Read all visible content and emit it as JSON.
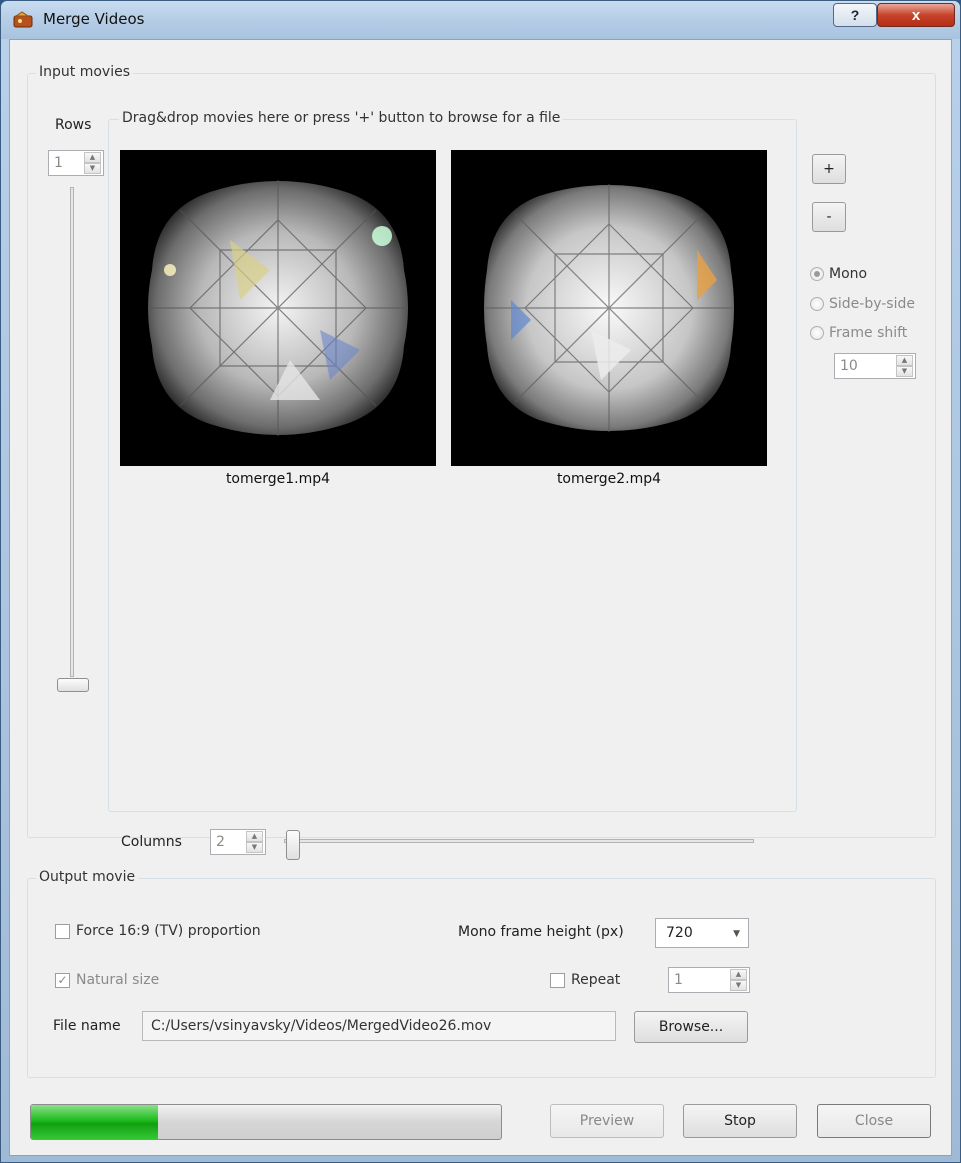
{
  "window": {
    "title": "Merge Videos",
    "help_label": "?",
    "close_label": "x"
  },
  "input_group": {
    "label": "Input movies",
    "rows_label": "Rows",
    "rows_value": "1",
    "drop_hint": "Drag&drop movies here or press '+' button to browse for a file",
    "add_label": "+",
    "remove_label": "-",
    "thumbnails": [
      {
        "name": "tomerge1.mp4"
      },
      {
        "name": "tomerge2.mp4"
      }
    ],
    "columns_label": "Columns",
    "columns_value": "2",
    "columns_slider_fraction": 0.0,
    "mode_options": [
      {
        "label": "Mono",
        "selected": true
      },
      {
        "label": "Side-by-side",
        "selected": false
      },
      {
        "label": "Frame shift",
        "selected": false
      }
    ],
    "frame_shift_value": "10"
  },
  "output_group": {
    "label": "Output  movie",
    "force_169_label": "Force 16:9 (TV) proportion",
    "force_169_checked": false,
    "mono_height_label": "Mono frame height (px)",
    "mono_height_value": "720",
    "natural_size_label": "Natural size",
    "natural_size_checked": true,
    "repeat_label": "Repeat",
    "repeat_checked": false,
    "repeat_value": "1",
    "file_name_label": "File name",
    "file_name_value": "C:/Users/vsinyavsky/Videos/MergedVideo26.mov",
    "browse_label": "Browse..."
  },
  "footer": {
    "progress_percent": 27,
    "preview_label": "Preview",
    "stop_label": "Stop",
    "close_label": "Close"
  },
  "colors": {
    "progress_fill": "#1fbb1f",
    "close_button": "#c7432b"
  }
}
